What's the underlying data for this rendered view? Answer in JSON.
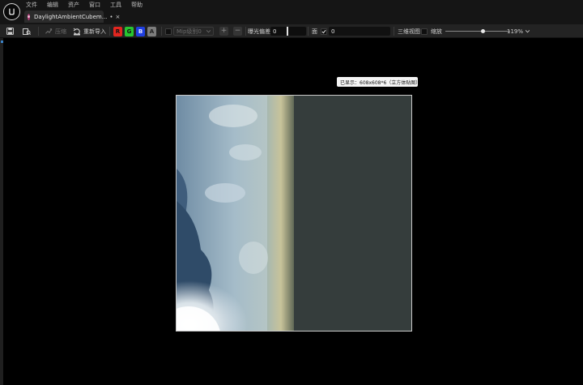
{
  "menu": {
    "items": [
      "文件",
      "编辑",
      "资产",
      "窗口",
      "工具",
      "帮助"
    ]
  },
  "tab": {
    "label": "DaylightAmbientCubem...",
    "modified": "•",
    "close": "×"
  },
  "toolbar": {
    "compress_label": "压缩",
    "reimport_label": "重新导入",
    "channels": [
      "R",
      "G",
      "B",
      "A"
    ],
    "mip_label": "Mip级别0",
    "exposure_label": "曝光偏差",
    "exposure_value": "0",
    "face_label": "面",
    "face_value": "0",
    "view_3d_label": "三维视图",
    "zoom_label": "缩放",
    "zoom_value": "119%",
    "zoom_fraction": 0.58
  },
  "viewport": {
    "tooltip": "已显示：608x608*6（立方体贴图）"
  },
  "colors": {
    "accent": "#3b82c6",
    "channel_r": "#e3261f",
    "channel_g": "#28c531",
    "channel_b": "#1f3fe0",
    "channel_a": "#7d7d7d",
    "tab_icon": "#b23a77"
  }
}
